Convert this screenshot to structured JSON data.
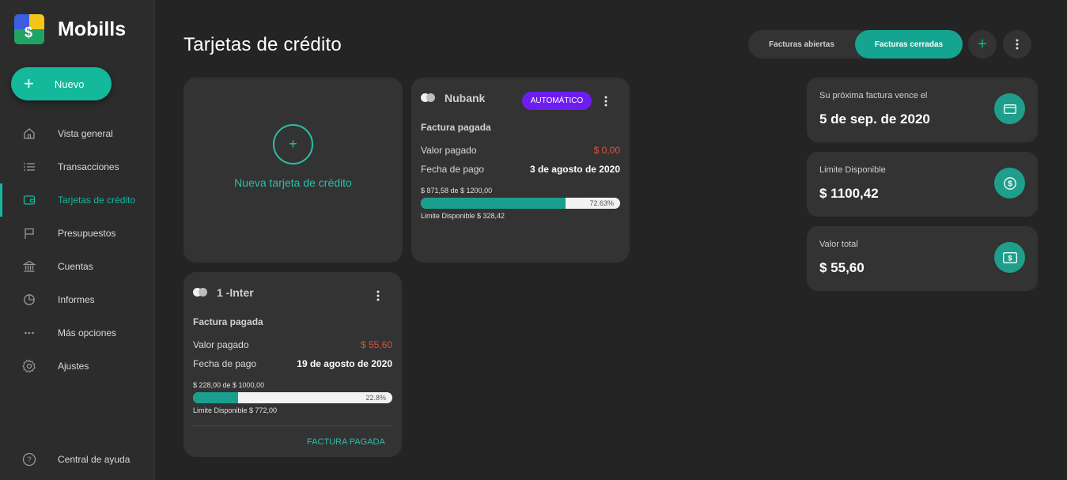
{
  "app": {
    "name": "Mobills"
  },
  "sidebar": {
    "new_button": "Nuevo",
    "items": [
      {
        "label": "Vista general",
        "icon": "home-icon"
      },
      {
        "label": "Transacciones",
        "icon": "list-icon"
      },
      {
        "label": "Tarjetas de crédito",
        "icon": "wallet-icon",
        "active": true
      },
      {
        "label": "Presupuestos",
        "icon": "flag-icon"
      },
      {
        "label": "Cuentas",
        "icon": "bank-icon"
      },
      {
        "label": "Informes",
        "icon": "pie-chart-icon"
      },
      {
        "label": "Más opciones",
        "icon": "more-horizontal-icon"
      },
      {
        "label": "Ajustes",
        "icon": "gear-icon"
      }
    ],
    "help": {
      "label": "Central de ayuda",
      "icon": "help-icon"
    }
  },
  "header": {
    "title": "Tarjetas de crédito",
    "tabs": [
      {
        "label": "Facturas abiertas"
      },
      {
        "label": "Facturas cerradas",
        "selected": true
      }
    ]
  },
  "new_card": {
    "label": "Nueva tarjeta de crédito"
  },
  "cards": [
    {
      "name": "Nubank",
      "badge": "AUTOMÁTICO",
      "status": "Factura pagada",
      "paid_label": "Valor pagado",
      "paid_value": "$ 0,00",
      "date_label": "Fecha de pago",
      "date_value": "3 de agosto de 2020",
      "usage": "$ 871,58 de $ 1200,00",
      "percent_text": "72.63%",
      "percent": 72.63,
      "available": "Limite Disponible $ 328,42"
    },
    {
      "name": "1 -Inter",
      "status": "Factura pagada",
      "paid_label": "Valor pagado",
      "paid_value": "$ 55,60",
      "date_label": "Fecha de pago",
      "date_value": "19 de agosto de 2020",
      "usage": "$ 228,00 de $ 1000,00",
      "percent_text": "22.8%",
      "percent": 22.8,
      "available": "Limite Disponible $ 772,00",
      "action": "FACTURA PAGADA"
    }
  ],
  "summary": [
    {
      "label": "Su próxima factura vence el",
      "value": "5 de sep. de 2020",
      "icon": "credit-card-icon"
    },
    {
      "label": "Limite Disponible",
      "value": "$ 1100,42",
      "icon": "coin-icon"
    },
    {
      "label": "Valor total",
      "value": "$ 55,60",
      "icon": "banknote-icon"
    }
  ],
  "colors": {
    "accent": "#14b89b",
    "badge": "#6e1df0",
    "negative": "#e74c3c",
    "background": "#242424",
    "card": "#333333"
  }
}
